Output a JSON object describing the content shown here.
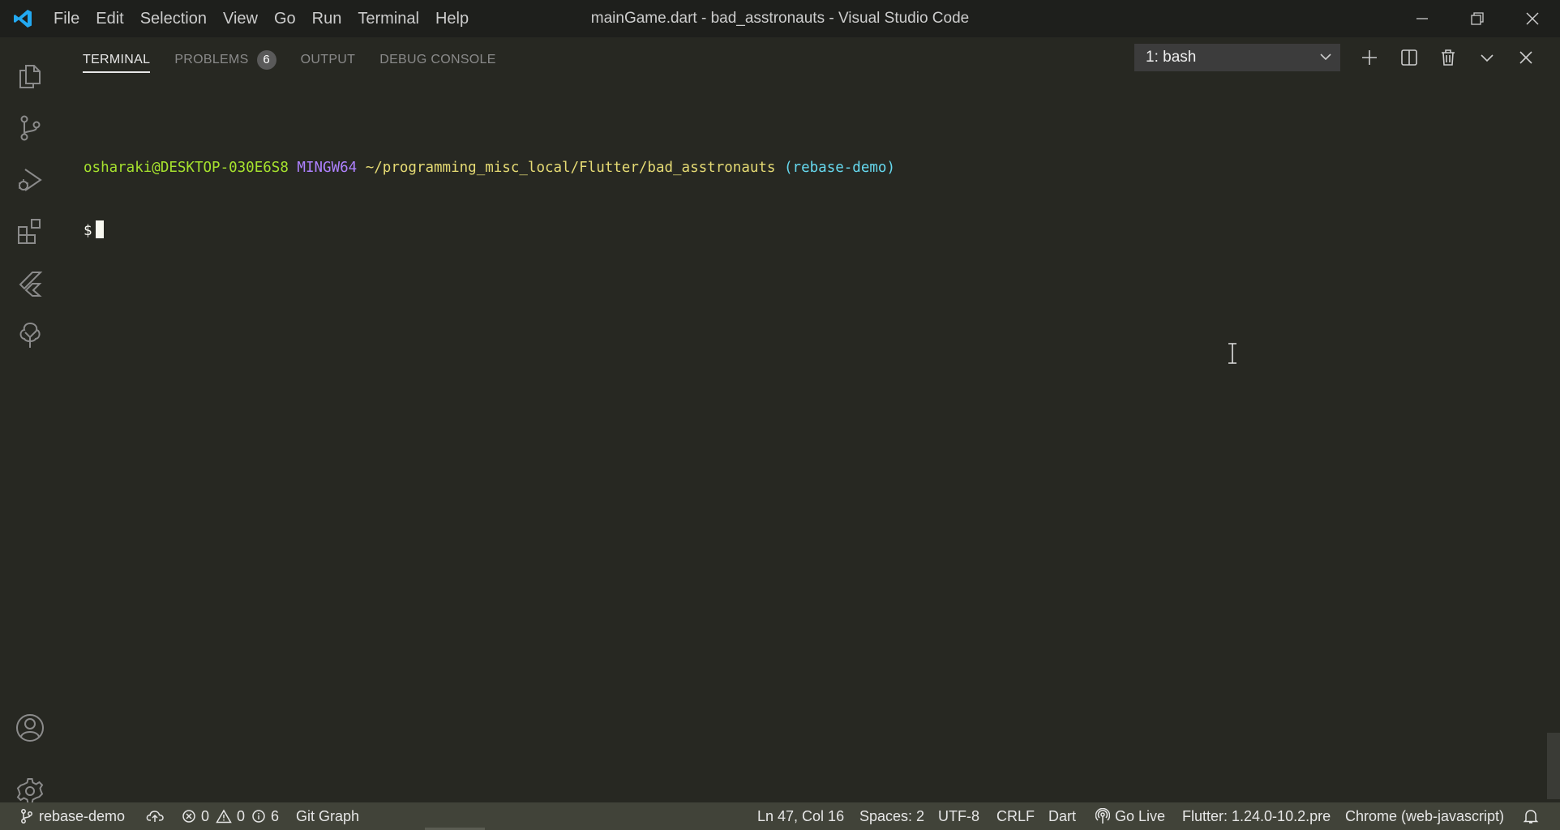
{
  "titlebar": {
    "menu": [
      "File",
      "Edit",
      "Selection",
      "View",
      "Go",
      "Run",
      "Terminal",
      "Help"
    ],
    "window_title": "mainGame.dart - bad_asstronauts - Visual Studio Code"
  },
  "activity_bar": [
    "explorer-icon",
    "source-control-icon",
    "run-debug-icon",
    "extensions-icon",
    "flutter-icon",
    "tree-icon",
    "account-icon",
    "settings-gear-icon"
  ],
  "panel": {
    "tabs": [
      {
        "label": "TERMINAL",
        "active": true
      },
      {
        "label": "PROBLEMS",
        "badge": "6"
      },
      {
        "label": "OUTPUT"
      },
      {
        "label": "DEBUG CONSOLE"
      }
    ],
    "terminal_select": "1: bash"
  },
  "terminal": {
    "user_host": "osharaki@DESKTOP-030E6S8",
    "system": "MINGW64",
    "path": "~/programming_misc_local/Flutter/bad_asstronauts",
    "branch": "(rebase-demo)",
    "prompt": "$"
  },
  "statusbar": {
    "branch": "rebase-demo",
    "errors": "0",
    "warnings": "0",
    "infos": "6",
    "git_graph": "Git Graph",
    "position": "Ln 47, Col 16",
    "spaces": "Spaces: 2",
    "encoding": "UTF-8",
    "eol": "CRLF",
    "language": "Dart",
    "go_live": "Go Live",
    "flutter": "Flutter: 1.24.0-10.2.pre",
    "device": "Chrome (web-javascript)"
  },
  "colors": {
    "background": "#272822",
    "titlebar": "#1e1f1c",
    "statusbar": "#414339",
    "user": "#a6e22e",
    "system": "#ae81ff",
    "path": "#e6db74",
    "branch": "#66d9ef"
  }
}
